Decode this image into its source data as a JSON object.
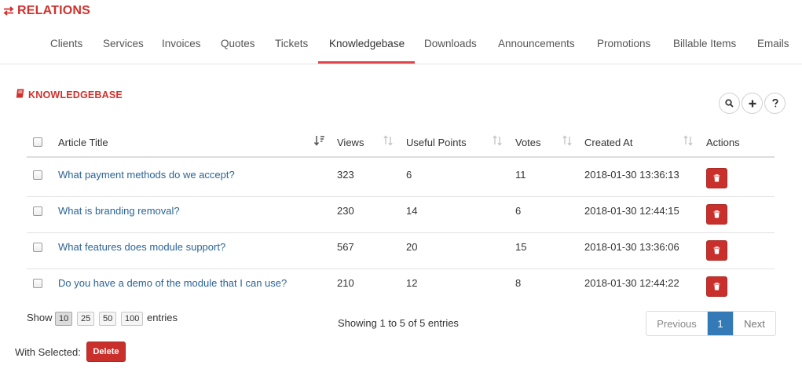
{
  "header": {
    "title": "RELATIONS",
    "icon": "exchange-icon",
    "accent": "#d0312d"
  },
  "tabs": [
    {
      "label": "Clients",
      "active": false
    },
    {
      "label": "Services",
      "active": false
    },
    {
      "label": "Invoices",
      "active": false
    },
    {
      "label": "Quotes",
      "active": false
    },
    {
      "label": "Tickets",
      "active": false
    },
    {
      "label": "Knowledgebase",
      "active": true
    },
    {
      "label": "Downloads",
      "active": false
    },
    {
      "label": "Announcements",
      "active": false
    },
    {
      "label": "Promotions",
      "active": false
    },
    {
      "label": "Billable Items",
      "active": false
    },
    {
      "label": "Emails",
      "active": false
    }
  ],
  "section": {
    "title": "KNOWLEDGEBASE",
    "icon": "book-icon"
  },
  "toolbar": {
    "icons": [
      "search-icon",
      "plus-icon",
      "question-icon"
    ]
  },
  "table": {
    "columns": [
      "Article Title",
      "Views",
      "Useful Points",
      "Votes",
      "Created At",
      "Actions"
    ],
    "rows": [
      {
        "title": "What payment methods do we accept?",
        "views": "323",
        "useful_points": "6",
        "votes": "11",
        "created_at": "2018-01-30 13:36:13"
      },
      {
        "title": "What is branding removal?",
        "views": "230",
        "useful_points": "14",
        "votes": "6",
        "created_at": "2018-01-30 12:44:15"
      },
      {
        "title": "What features does module support?",
        "views": "567",
        "useful_points": "20",
        "votes": "15",
        "created_at": "2018-01-30 13:36:06"
      },
      {
        "title": "Do you have a demo of the module that I can use?",
        "views": "210",
        "useful_points": "12",
        "votes": "8",
        "created_at": "2018-01-30 12:44:22"
      }
    ]
  },
  "footer": {
    "show_label": "Show",
    "page_sizes": [
      "10",
      "25",
      "50",
      "100"
    ],
    "selected_page_size": "10",
    "entries_label": "entries",
    "info": "Showing 1 to 5 of 5 entries",
    "prev_label": "Previous",
    "current_page": "1",
    "next_label": "Next",
    "with_selected_label": "With Selected:",
    "delete_label": "Delete"
  },
  "colors": {
    "accent": "#d0312d",
    "link": "#2a6496",
    "danger": "#c9302c",
    "primary": "#337ab7",
    "tab_underline": "#e0464c"
  }
}
